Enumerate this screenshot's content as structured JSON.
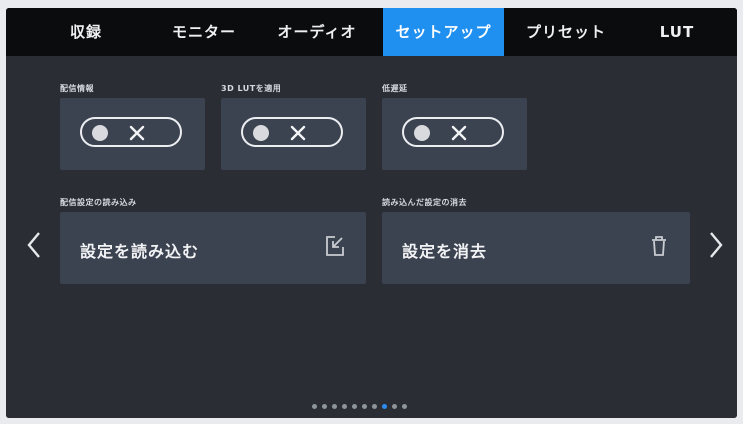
{
  "tabs": [
    {
      "label": "収録"
    },
    {
      "label": "モニター"
    },
    {
      "label": "オーディオ"
    },
    {
      "label": "セットアップ"
    },
    {
      "label": "プリセット"
    },
    {
      "label": "LUT"
    }
  ],
  "active_tab": "セットアップ",
  "toggles": [
    {
      "label": "配信情報",
      "state": "off"
    },
    {
      "label": "3D LUTを適用",
      "state": "off"
    },
    {
      "label": "低遅延",
      "state": "off"
    }
  ],
  "load_settings": {
    "label": "配信設定の読み込み",
    "button": "設定を読み込む",
    "icon": "import-icon"
  },
  "clear_settings": {
    "label": "読み込んだ設定の消去",
    "button": "設定を消去",
    "icon": "trash-icon"
  },
  "pagination": {
    "total": 10,
    "current": 8
  },
  "colors": {
    "accent": "#1f8ff0",
    "panel": "#3b4250",
    "background": "#2a2e34",
    "tabbar": "#0b0c0e"
  }
}
